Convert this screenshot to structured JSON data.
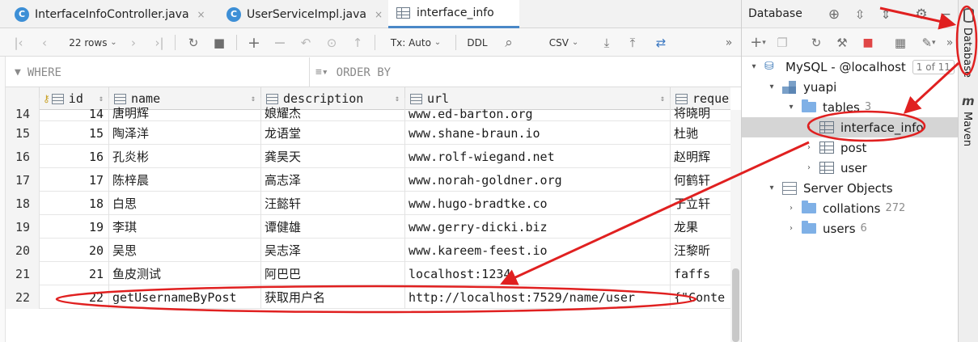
{
  "tabs": [
    {
      "label": "InterfaceInfoController.java",
      "close": "×"
    },
    {
      "label": "UserServiceImpl.java",
      "close": "×"
    },
    {
      "label": "interface_info"
    }
  ],
  "toolbar": {
    "rows": "22 rows",
    "tx": "Tx: Auto",
    "ddl": "DDL",
    "csv": "CSV",
    "more": "»"
  },
  "filters": {
    "where": "WHERE",
    "order_by": "ORDER BY"
  },
  "columns": [
    "id",
    "name",
    "description",
    "url",
    "reque"
  ],
  "rows": [
    {
      "rownum": "14",
      "id": "14",
      "name": "唐明辉",
      "description": "娘耀杰",
      "url": "www.ed-barton.org",
      "request": "将晓明"
    },
    {
      "rownum": "15",
      "id": "15",
      "name": "陶泽洋",
      "description": "龙语堂",
      "url": "www.shane-braun.io",
      "request": "杜驰"
    },
    {
      "rownum": "16",
      "id": "16",
      "name": "孔炎彬",
      "description": "龚昊天",
      "url": "www.rolf-wiegand.net",
      "request": "赵明辉"
    },
    {
      "rownum": "17",
      "id": "17",
      "name": "陈梓晨",
      "description": "高志泽",
      "url": "www.norah-goldner.org",
      "request": "何鹤轩"
    },
    {
      "rownum": "18",
      "id": "18",
      "name": "白思",
      "description": "汪懿轩",
      "url": "www.hugo-bradtke.co",
      "request": "于立轩"
    },
    {
      "rownum": "19",
      "id": "19",
      "name": "李琪",
      "description": "谭健雄",
      "url": "www.gerry-dicki.biz",
      "request": "龙果"
    },
    {
      "rownum": "20",
      "id": "20",
      "name": "吴思",
      "description": "吴志泽",
      "url": "www.kareem-feest.io",
      "request": "汪黎昕"
    },
    {
      "rownum": "21",
      "id": "21",
      "name": "鱼皮测试",
      "description": "阿巴巴",
      "url": "localhost:1234",
      "request": "faffs"
    },
    {
      "rownum": "22",
      "id": "22",
      "name": "getUsernameByPost",
      "description": "获取用户名",
      "url": "http://localhost:7529/name/user",
      "request": "{\"Conte"
    }
  ],
  "db_panel": {
    "title": "Database",
    "more": "»",
    "tree": [
      {
        "label": "MySQL - @localhost",
        "badge": "1 of 11"
      },
      {
        "label": "yuapi"
      },
      {
        "label": "tables",
        "count": "3"
      },
      {
        "label": "interface_info"
      },
      {
        "label": "post"
      },
      {
        "label": "user"
      },
      {
        "label": "Server Objects"
      },
      {
        "label": "collations",
        "count": "272"
      },
      {
        "label": "users",
        "count": "6"
      }
    ]
  },
  "right_strip": {
    "database": "Database",
    "maven": "Maven",
    "maven_glyph": "m"
  },
  "colors": {
    "accent": "#4a88c7",
    "annotation": "#e02020",
    "selection": "#d5d5d5"
  }
}
